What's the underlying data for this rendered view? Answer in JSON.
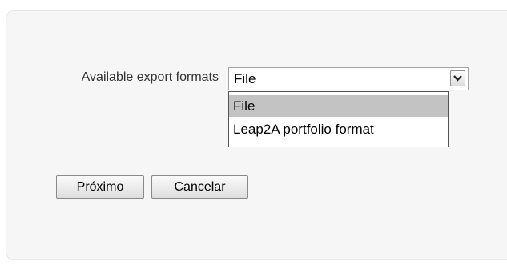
{
  "form": {
    "field_label": "Available export formats",
    "select": {
      "selected_value": "File",
      "options": [
        "File",
        "Leap2A portfolio format"
      ],
      "highlighted_option": "File"
    },
    "buttons": {
      "next_label": "Próximo",
      "cancel_label": "Cancelar"
    }
  },
  "icons": {
    "select_arrow": "chevron-down-icon"
  },
  "colors": {
    "panel_background": "#f6f6f6",
    "highlighted_option_background": "#c3c3c3"
  }
}
